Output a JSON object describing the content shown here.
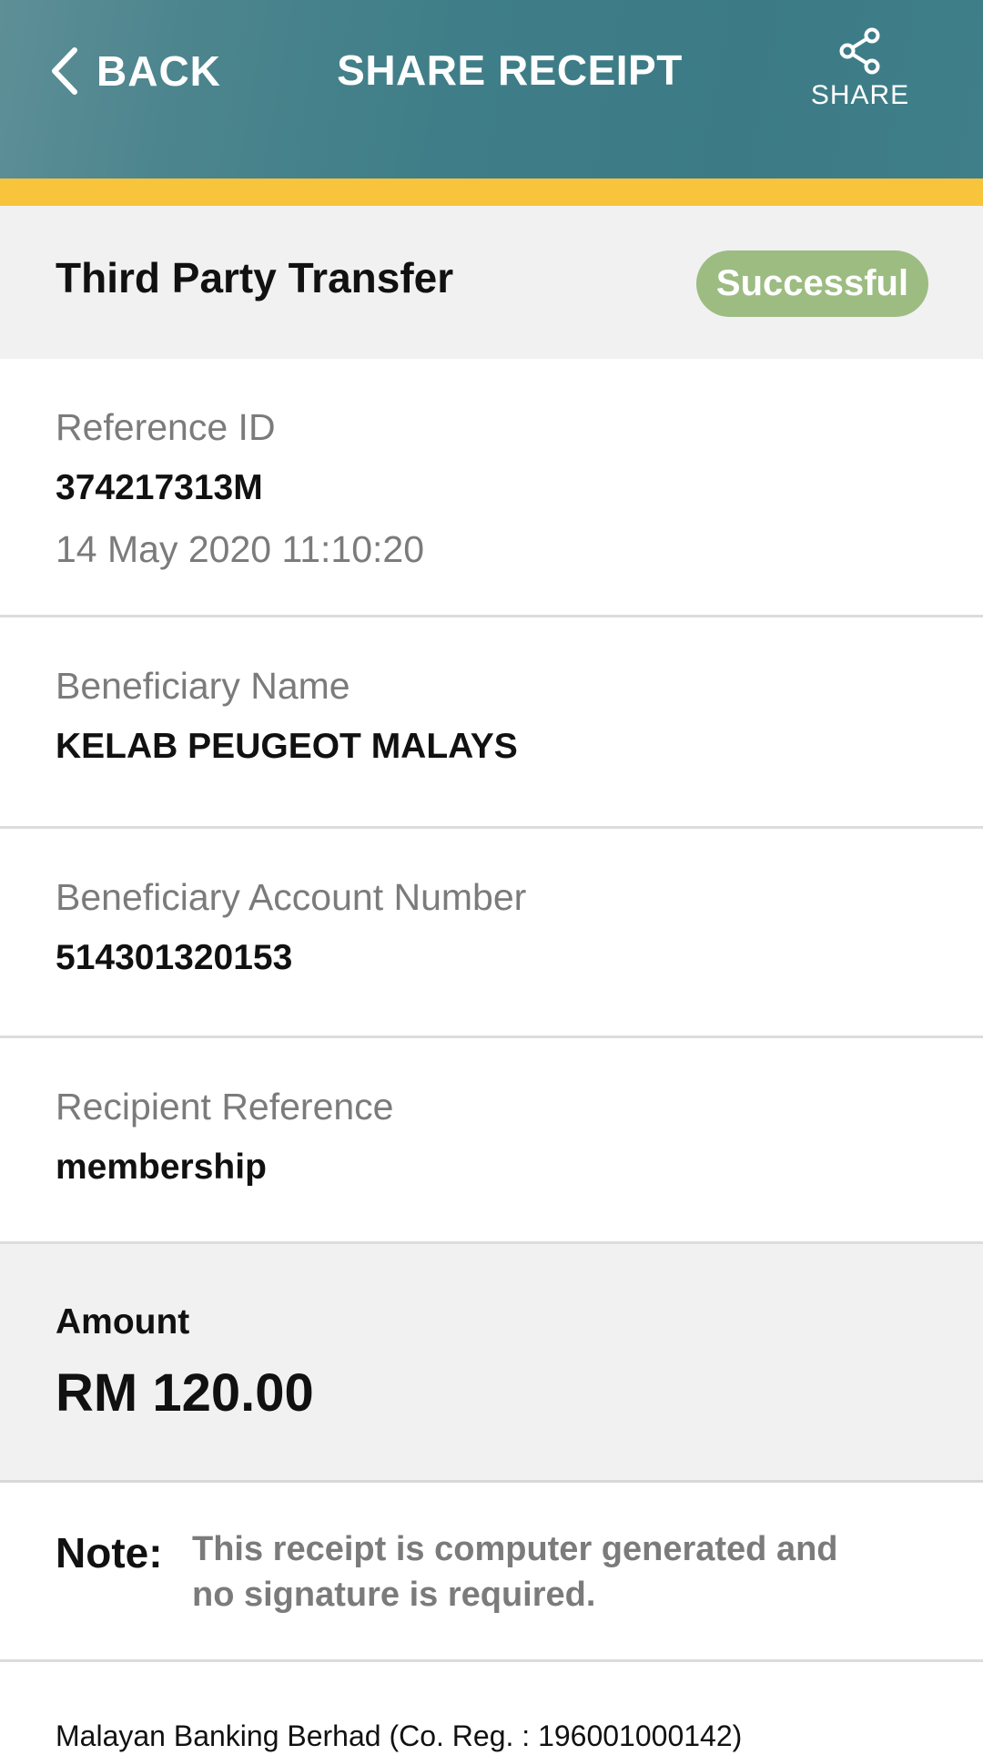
{
  "header": {
    "back_label": "BACK",
    "title": "SHARE RECEIPT",
    "share_label": "SHARE"
  },
  "summary": {
    "title": "Third Party Transfer",
    "status": "Successful"
  },
  "reference": {
    "label": "Reference ID",
    "value": "374217313M",
    "datetime": "14 May 2020 11:10:20"
  },
  "beneficiary_name": {
    "label": "Beneficiary Name",
    "value": "KELAB PEUGEOT MALAYS"
  },
  "beneficiary_account": {
    "label": "Beneficiary Account Number",
    "value": "514301320153"
  },
  "recipient_reference": {
    "label": "Recipient Reference",
    "value": "membership"
  },
  "amount": {
    "label": "Amount",
    "value": "RM 120.00"
  },
  "note": {
    "label": "Note:",
    "line1": "This receipt is computer generated and",
    "line2": "no signature is required."
  },
  "footer": {
    "text": "Malayan Banking Berhad (Co. Reg. : 196001000142)"
  },
  "colors": {
    "header_teal": "#3f7e88",
    "stripe_yellow": "#f7c43c",
    "badge_green": "#9cbc82"
  }
}
